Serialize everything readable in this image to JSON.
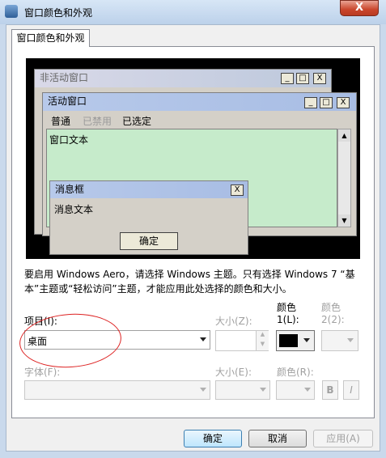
{
  "window": {
    "title": "窗口颜色和外观",
    "close_glyph": "X"
  },
  "tab": {
    "label": "窗口颜色和外观"
  },
  "preview": {
    "inactive_title": "非活动窗口",
    "active_title": "活动窗口",
    "menu": [
      "普通",
      "已禁用",
      "已选定"
    ],
    "window_text": "窗口文本",
    "msgbox_title": "消息框",
    "msgbox_text": "消息文本",
    "ok": "确定",
    "window_buttons": [
      "_",
      "□",
      "X"
    ]
  },
  "description": "要启用 Windows Aero，请选择 Windows 主题。只有选择 Windows 7 “基本”主题或“轻松访问”主题，才能应用此处选择的颜色和大小。",
  "item": {
    "label": "项目(I):",
    "value": "桌面"
  },
  "size1": {
    "label": "大小(Z):"
  },
  "color1": {
    "label_line1": "颜色",
    "label_line2": "1(L):",
    "swatch": "#000000"
  },
  "color2": {
    "label_line1": "颜色",
    "label_line2": "2(2):"
  },
  "font": {
    "label": "字体(F):"
  },
  "size2": {
    "label": "大小(E):"
  },
  "font_color": {
    "label": "颜色(R):"
  },
  "bold": "B",
  "italic": "I",
  "buttons": {
    "ok": "确定",
    "cancel": "取消",
    "apply": "应用(A)"
  }
}
